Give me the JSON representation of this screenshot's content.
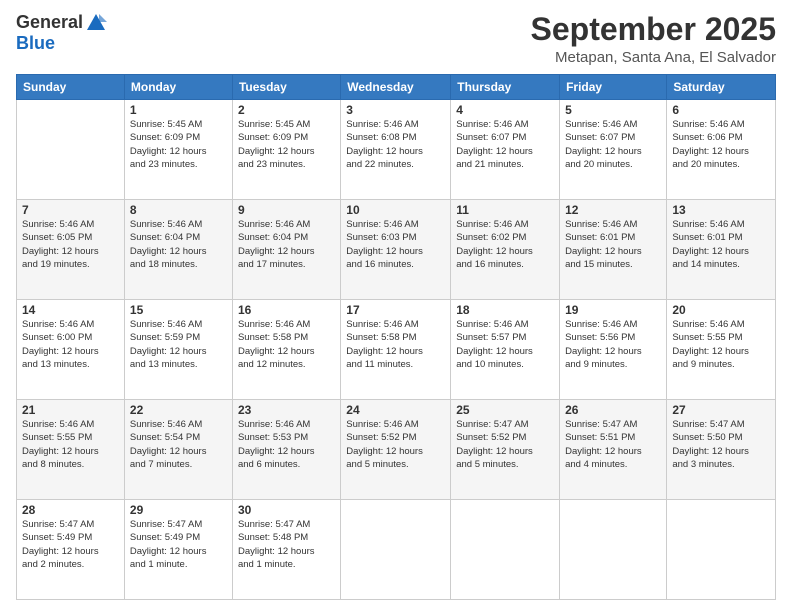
{
  "header": {
    "logo_general": "General",
    "logo_blue": "Blue",
    "month_title": "September 2025",
    "location": "Metapan, Santa Ana, El Salvador"
  },
  "days_of_week": [
    "Sunday",
    "Monday",
    "Tuesday",
    "Wednesday",
    "Thursday",
    "Friday",
    "Saturday"
  ],
  "weeks": [
    [
      {
        "day": "",
        "info": ""
      },
      {
        "day": "1",
        "info": "Sunrise: 5:45 AM\nSunset: 6:09 PM\nDaylight: 12 hours\nand 23 minutes."
      },
      {
        "day": "2",
        "info": "Sunrise: 5:45 AM\nSunset: 6:09 PM\nDaylight: 12 hours\nand 23 minutes."
      },
      {
        "day": "3",
        "info": "Sunrise: 5:46 AM\nSunset: 6:08 PM\nDaylight: 12 hours\nand 22 minutes."
      },
      {
        "day": "4",
        "info": "Sunrise: 5:46 AM\nSunset: 6:07 PM\nDaylight: 12 hours\nand 21 minutes."
      },
      {
        "day": "5",
        "info": "Sunrise: 5:46 AM\nSunset: 6:07 PM\nDaylight: 12 hours\nand 20 minutes."
      },
      {
        "day": "6",
        "info": "Sunrise: 5:46 AM\nSunset: 6:06 PM\nDaylight: 12 hours\nand 20 minutes."
      }
    ],
    [
      {
        "day": "7",
        "info": "Sunrise: 5:46 AM\nSunset: 6:05 PM\nDaylight: 12 hours\nand 19 minutes."
      },
      {
        "day": "8",
        "info": "Sunrise: 5:46 AM\nSunset: 6:04 PM\nDaylight: 12 hours\nand 18 minutes."
      },
      {
        "day": "9",
        "info": "Sunrise: 5:46 AM\nSunset: 6:04 PM\nDaylight: 12 hours\nand 17 minutes."
      },
      {
        "day": "10",
        "info": "Sunrise: 5:46 AM\nSunset: 6:03 PM\nDaylight: 12 hours\nand 16 minutes."
      },
      {
        "day": "11",
        "info": "Sunrise: 5:46 AM\nSunset: 6:02 PM\nDaylight: 12 hours\nand 16 minutes."
      },
      {
        "day": "12",
        "info": "Sunrise: 5:46 AM\nSunset: 6:01 PM\nDaylight: 12 hours\nand 15 minutes."
      },
      {
        "day": "13",
        "info": "Sunrise: 5:46 AM\nSunset: 6:01 PM\nDaylight: 12 hours\nand 14 minutes."
      }
    ],
    [
      {
        "day": "14",
        "info": "Sunrise: 5:46 AM\nSunset: 6:00 PM\nDaylight: 12 hours\nand 13 minutes."
      },
      {
        "day": "15",
        "info": "Sunrise: 5:46 AM\nSunset: 5:59 PM\nDaylight: 12 hours\nand 13 minutes."
      },
      {
        "day": "16",
        "info": "Sunrise: 5:46 AM\nSunset: 5:58 PM\nDaylight: 12 hours\nand 12 minutes."
      },
      {
        "day": "17",
        "info": "Sunrise: 5:46 AM\nSunset: 5:58 PM\nDaylight: 12 hours\nand 11 minutes."
      },
      {
        "day": "18",
        "info": "Sunrise: 5:46 AM\nSunset: 5:57 PM\nDaylight: 12 hours\nand 10 minutes."
      },
      {
        "day": "19",
        "info": "Sunrise: 5:46 AM\nSunset: 5:56 PM\nDaylight: 12 hours\nand 9 minutes."
      },
      {
        "day": "20",
        "info": "Sunrise: 5:46 AM\nSunset: 5:55 PM\nDaylight: 12 hours\nand 9 minutes."
      }
    ],
    [
      {
        "day": "21",
        "info": "Sunrise: 5:46 AM\nSunset: 5:55 PM\nDaylight: 12 hours\nand 8 minutes."
      },
      {
        "day": "22",
        "info": "Sunrise: 5:46 AM\nSunset: 5:54 PM\nDaylight: 12 hours\nand 7 minutes."
      },
      {
        "day": "23",
        "info": "Sunrise: 5:46 AM\nSunset: 5:53 PM\nDaylight: 12 hours\nand 6 minutes."
      },
      {
        "day": "24",
        "info": "Sunrise: 5:46 AM\nSunset: 5:52 PM\nDaylight: 12 hours\nand 5 minutes."
      },
      {
        "day": "25",
        "info": "Sunrise: 5:47 AM\nSunset: 5:52 PM\nDaylight: 12 hours\nand 5 minutes."
      },
      {
        "day": "26",
        "info": "Sunrise: 5:47 AM\nSunset: 5:51 PM\nDaylight: 12 hours\nand 4 minutes."
      },
      {
        "day": "27",
        "info": "Sunrise: 5:47 AM\nSunset: 5:50 PM\nDaylight: 12 hours\nand 3 minutes."
      }
    ],
    [
      {
        "day": "28",
        "info": "Sunrise: 5:47 AM\nSunset: 5:49 PM\nDaylight: 12 hours\nand 2 minutes."
      },
      {
        "day": "29",
        "info": "Sunrise: 5:47 AM\nSunset: 5:49 PM\nDaylight: 12 hours\nand 1 minute."
      },
      {
        "day": "30",
        "info": "Sunrise: 5:47 AM\nSunset: 5:48 PM\nDaylight: 12 hours\nand 1 minute."
      },
      {
        "day": "",
        "info": ""
      },
      {
        "day": "",
        "info": ""
      },
      {
        "day": "",
        "info": ""
      },
      {
        "day": "",
        "info": ""
      }
    ]
  ]
}
